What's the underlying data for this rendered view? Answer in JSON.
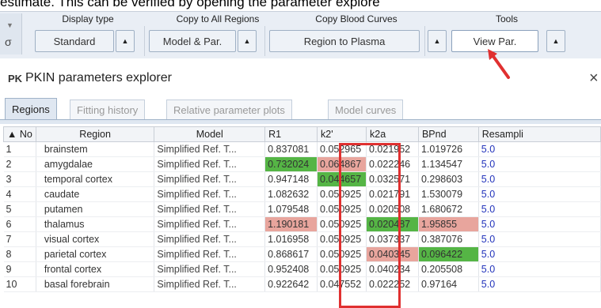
{
  "caption": "estimate. This can be verified by opening the parameter explore",
  "toolbar": {
    "headers": [
      "Display type",
      "Copy to All Regions",
      "Copy Blood Curves",
      "Tools"
    ],
    "buttons": [
      "Standard",
      "Model & Par.",
      "Region to Plasma",
      "View Par."
    ],
    "arrow_glyph": "▲"
  },
  "window": {
    "title": "PKIN parameters explorer",
    "icon_text": "PK",
    "close_glyph": "×"
  },
  "tabs": [
    "Regions",
    "Fitting history",
    "Relative parameter plots",
    "Model curves"
  ],
  "table": {
    "columns": [
      "▲ No",
      "Region",
      "Model",
      "R1",
      "k2'",
      "k2a",
      "BPnd",
      "Resampli"
    ],
    "rows": [
      [
        "1",
        "brainstem",
        "Simplified Ref. T...",
        "0.837081",
        "0.052965",
        "0.021952",
        "1.019726",
        "5.0"
      ],
      [
        "2",
        "amygdalae",
        "Simplified Ref. T...",
        "0.732024",
        "0.064867",
        "0.022246",
        "1.134547",
        "5.0"
      ],
      [
        "3",
        "temporal cortex",
        "Simplified Ref. T...",
        "0.947148",
        "0.044657",
        "0.032571",
        "0.298603",
        "5.0"
      ],
      [
        "4",
        "caudate",
        "Simplified Ref. T...",
        "1.082632",
        "0.050925",
        "0.021791",
        "1.530079",
        "5.0"
      ],
      [
        "5",
        "putamen",
        "Simplified Ref. T...",
        "1.079548",
        "0.050925",
        "0.020508",
        "1.680672",
        "5.0"
      ],
      [
        "6",
        "thalamus",
        "Simplified Ref. T...",
        "1.190181",
        "0.050925",
        "0.020487",
        "1.95855",
        "5.0"
      ],
      [
        "7",
        "visual cortex",
        "Simplified Ref. T...",
        "1.016958",
        "0.050925",
        "0.037337",
        "0.387076",
        "5.0"
      ],
      [
        "8",
        "parietal cortex",
        "Simplified Ref. T...",
        "0.868617",
        "0.050925",
        "0.040345",
        "0.096422",
        "5.0"
      ],
      [
        "9",
        "frontal cortex",
        "Simplified Ref. T...",
        "0.952408",
        "0.050925",
        "0.040234",
        "0.205508",
        "5.0"
      ],
      [
        "10",
        "basal forebrain",
        "Simplified Ref. T...",
        "0.922642",
        "0.047552",
        "0.022252",
        "0.97164",
        "5.0"
      ]
    ],
    "highlights": {
      "green": "#55b545",
      "pink": "#e8a59d"
    }
  }
}
